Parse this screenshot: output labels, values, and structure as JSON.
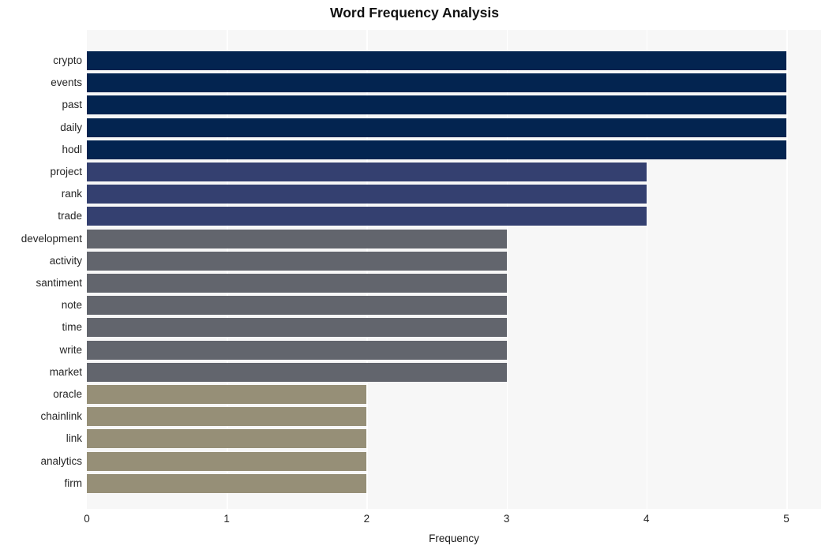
{
  "chart_data": {
    "type": "bar",
    "orientation": "horizontal",
    "title": "Word Frequency Analysis",
    "xlabel": "Frequency",
    "ylabel": "",
    "xlim": [
      0,
      5
    ],
    "xticks": [
      0,
      1,
      2,
      3,
      4,
      5
    ],
    "xtick_labels": [
      "0",
      "1",
      "2",
      "3",
      "4",
      "5"
    ],
    "grid": true,
    "grid_axis": "x",
    "legend": false,
    "categories": [
      "crypto",
      "events",
      "past",
      "daily",
      "hodl",
      "project",
      "rank",
      "trade",
      "development",
      "activity",
      "santiment",
      "note",
      "time",
      "write",
      "market",
      "oracle",
      "chainlink",
      "link",
      "analytics",
      "firm"
    ],
    "values": [
      5,
      5,
      5,
      5,
      5,
      4,
      4,
      4,
      3,
      3,
      3,
      3,
      3,
      3,
      3,
      2,
      2,
      2,
      2,
      2
    ],
    "bar_colors": [
      "#032450",
      "#032450",
      "#032450",
      "#032450",
      "#032450",
      "#344070",
      "#344070",
      "#344070",
      "#62656d",
      "#62656d",
      "#62656d",
      "#62656d",
      "#62656d",
      "#62656d",
      "#62656d",
      "#968f77",
      "#968f77",
      "#968f77",
      "#968f77",
      "#968f77"
    ],
    "plot_background": "#f7f7f7",
    "figure_background": "#ffffff",
    "gridline_color": "#ffffff"
  }
}
